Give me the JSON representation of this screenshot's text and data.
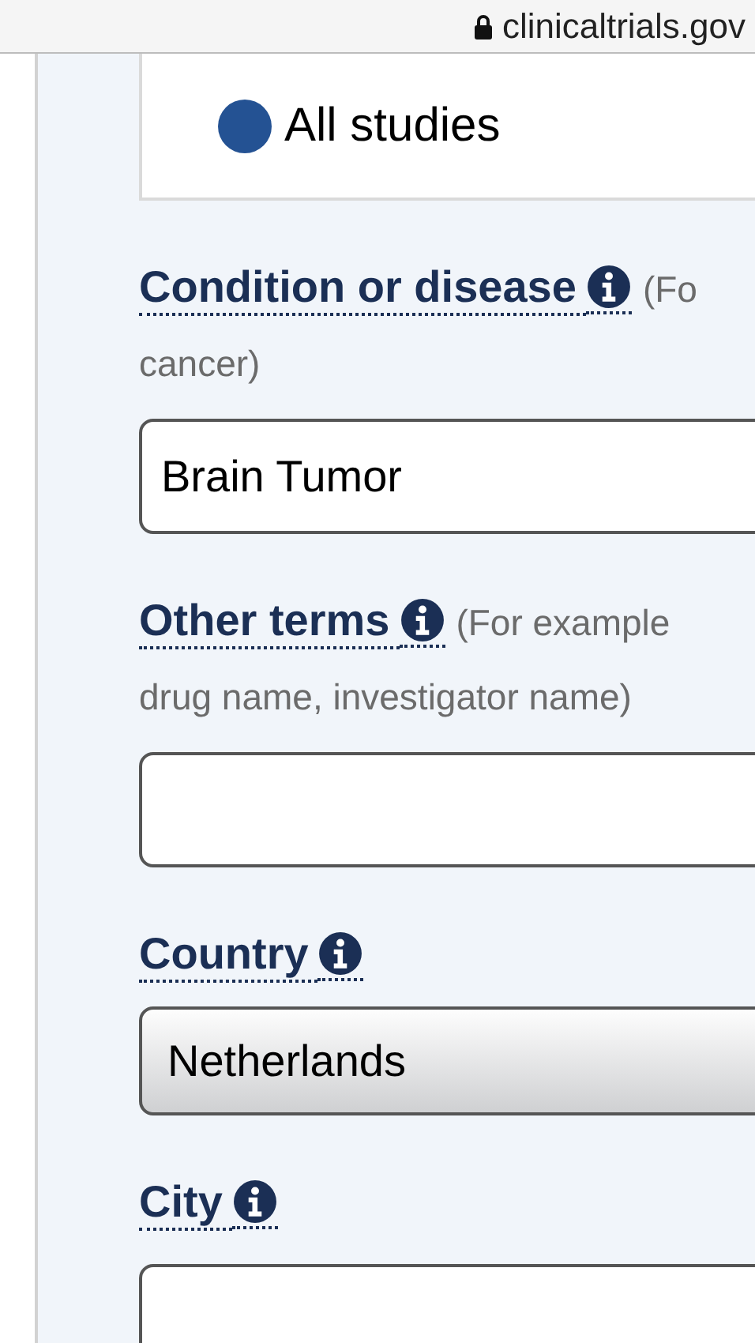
{
  "address_bar": {
    "url": "clinicaltrials.gov"
  },
  "study_filter": {
    "label": "All studies",
    "selected": true
  },
  "fields": [
    {
      "label": "Condition or disease",
      "hint_lines": [
        "(Fo",
        "cancer)"
      ],
      "kind": "text",
      "value": "Brain Tumor"
    },
    {
      "label": "Other terms",
      "hint_lines": [
        "(For example",
        "drug name, investigator name)"
      ],
      "kind": "text"
    },
    {
      "label": "Country",
      "kind": "select",
      "value": "Netherlands"
    },
    {
      "label": "City",
      "kind": "text"
    }
  ]
}
